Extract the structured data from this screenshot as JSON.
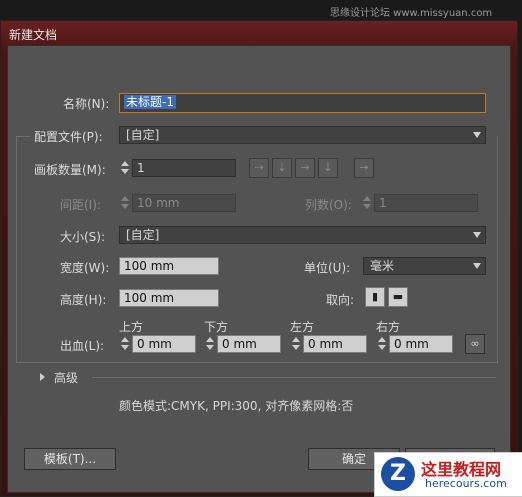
{
  "watermark_top": "思缘设计论坛 www.missyuan.com",
  "window": {
    "title": "新建文档"
  },
  "form": {
    "name_label": "名称(N):",
    "name_value": "未标题-1",
    "profile_label": "配置文件(P):",
    "profile_value": "[自定]",
    "artboards_label": "画板数量(M):",
    "artboards_value": "1",
    "spacing_label": "间距(I):",
    "spacing_value": "10 mm",
    "columns_label": "列数(O):",
    "columns_value": "1",
    "size_label": "大小(S):",
    "size_value": "[自定]",
    "width_label": "宽度(W):",
    "width_value": "100 mm",
    "units_label": "单位(U):",
    "units_value": "毫米",
    "height_label": "高度(H):",
    "height_value": "100 mm",
    "orientation_label": "取向:",
    "bleed_label": "出血(L):",
    "bleed": {
      "top_label": "上方",
      "top_value": "0 mm",
      "bottom_label": "下方",
      "bottom_value": "0 mm",
      "left_label": "左方",
      "left_value": "0 mm",
      "right_label": "右方",
      "right_value": "0 mm"
    },
    "advanced_label": "高级",
    "info_text": "颜色模式:CMYK, PPI:300, 对齐像素网格:否"
  },
  "buttons": {
    "templates": "模板(T)...",
    "ok": "确定",
    "cancel": "取消"
  },
  "logo": {
    "text_main": "这里教程网",
    "text_sub": "herecours.com",
    "glyph": "Z"
  },
  "icons": {
    "arrange_grid_row": "grid-by-row-icon",
    "arrange_grid_col": "grid-by-column-icon",
    "arrange_row": "arrange-by-row-icon",
    "arrange_col": "arrange-by-column-icon",
    "layout_rtl": "right-to-left-icon",
    "portrait": "portrait-icon",
    "landscape": "landscape-icon",
    "link": "chain-link-icon",
    "advanced_toggle": "triangle-right-icon"
  },
  "colors": {
    "title_bar": "#6b2020",
    "panel": "#535353",
    "focus": "#c87a1a",
    "selection": "#3d6bb8"
  }
}
